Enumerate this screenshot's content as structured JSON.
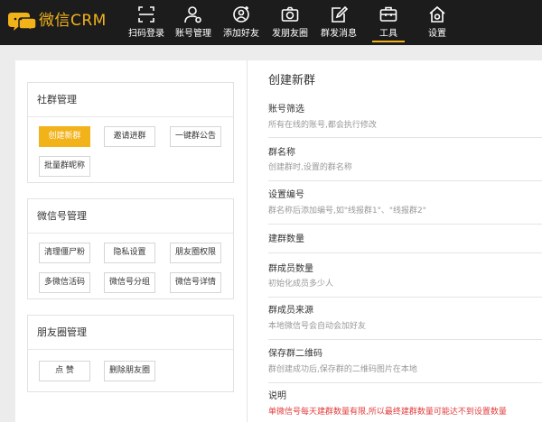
{
  "app": {
    "logo_text": "微信CRM",
    "brand_color": "#f2b21a"
  },
  "nav": {
    "items": [
      {
        "label": "扫码登录",
        "icon": "scan-icon"
      },
      {
        "label": "账号管理",
        "icon": "user-gear-icon"
      },
      {
        "label": "添加好友",
        "icon": "add-friend-icon"
      },
      {
        "label": "发朋友圈",
        "icon": "camera-icon"
      },
      {
        "label": "群发消息",
        "icon": "edit-icon"
      },
      {
        "label": "工具",
        "icon": "toolbox-icon",
        "active": true
      },
      {
        "label": "设置",
        "icon": "home-gear-icon"
      }
    ]
  },
  "left": {
    "group_mgmt": {
      "title": "社群管理",
      "buttons": [
        "创建新群",
        "邀请进群",
        "一键群公告",
        "批量群昵称"
      ]
    },
    "wechat_mgmt": {
      "title": "微信号管理",
      "buttons": [
        "清理僵尸粉",
        "隐私设置",
        "朋友圈权限",
        "多微信活码",
        "微信号分组",
        "微信号详情"
      ]
    },
    "moments_mgmt": {
      "title": "朋友圈管理",
      "buttons": [
        "点 赞",
        "删除朋友圈"
      ]
    }
  },
  "form": {
    "title": "创建新群",
    "rows": [
      {
        "label": "账号筛选",
        "hint": "所有在线的账号,都会执行修改"
      },
      {
        "label": "群名称",
        "hint": "创建群时,设置的群名称"
      },
      {
        "label": "设置编号",
        "hint": "群名称后添加编号,如\"线报群1\"、\"线报群2\""
      },
      {
        "label": "建群数量",
        "hint": ""
      },
      {
        "label": "群成员数量",
        "hint": "初始化成员多少人"
      },
      {
        "label": "群成员来源",
        "hint": "本地微信号会自动会加好友"
      },
      {
        "label": "保存群二维码",
        "hint": "群创建成功后,保存群的二维码图片在本地"
      },
      {
        "label": "说明",
        "hint": "单微信号每天建群数量有限,所以最终建群数量可能达不到设置数量"
      }
    ]
  },
  "colors": {
    "topbar": "#1c1c1c",
    "warn": "#e23c3c"
  }
}
